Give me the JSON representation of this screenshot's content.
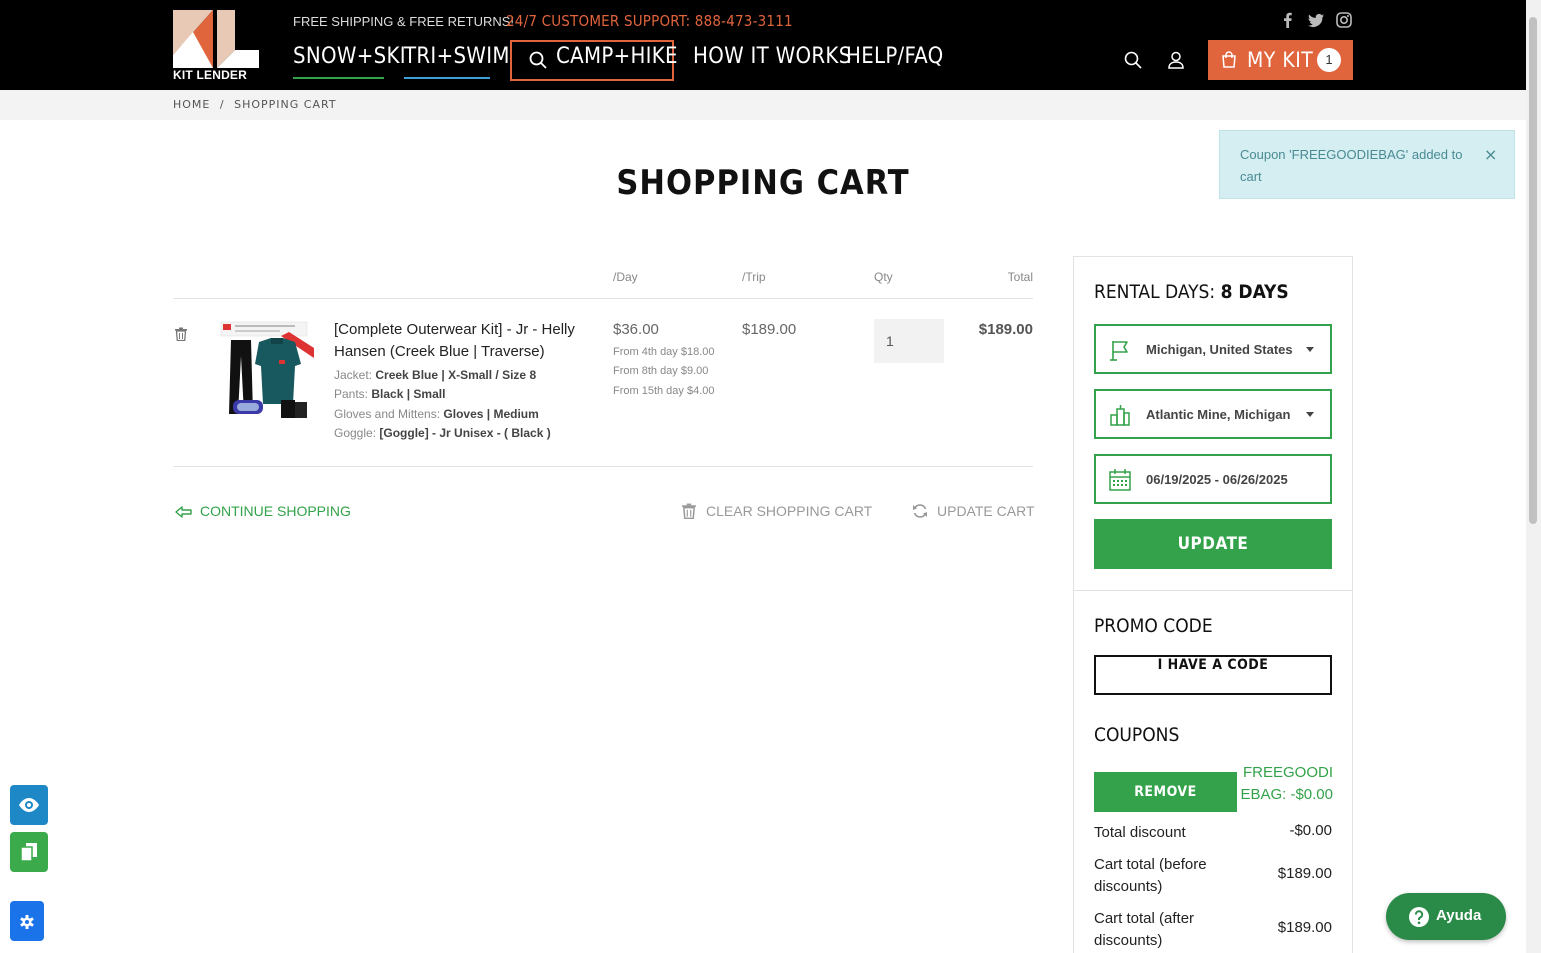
{
  "header": {
    "logo_text": "KIT LENDER",
    "promo": "FREE SHIPPING & FREE RETURNS!",
    "support": "24/7 CUSTOMER SUPPORT: 888-473-3111",
    "nav": [
      "SNOW+SKI",
      "TRI+SWIM",
      "CAMP+HIKE",
      "HOW IT WORKS",
      "HELP/FAQ"
    ],
    "kit_label": "MY KIT",
    "kit_count": "1",
    "accent_color": "#e0643c"
  },
  "breadcrumb": [
    "HOME",
    "/",
    "SHOPPING CART"
  ],
  "toast": {
    "message": "Coupon 'FREEGOODIEBAG' added to cart",
    "close": "×"
  },
  "page_title": "SHOPPING CART",
  "cart": {
    "columns": {
      "day": "/Day",
      "trip": "/Trip",
      "qty": "Qty",
      "total": "Total"
    },
    "item": {
      "title": "[Complete Outerwear Kit] - Jr - Helly Hansen (Creek Blue | Traverse)",
      "attributes": [
        {
          "label": "Jacket:",
          "value": "Creek Blue | X-Small / Size 8"
        },
        {
          "label": "Pants:",
          "value": "Black | Small"
        },
        {
          "label": "Gloves and Mittens:",
          "value": "Gloves | Medium"
        },
        {
          "label": "Goggle:",
          "value": "[Goggle] - Jr Unisex - ( Black )"
        }
      ],
      "price_day": "$36.00",
      "tiers": [
        "From 4th day $18.00",
        "From 8th day $9.00",
        "From 15th day $4.00"
      ],
      "price_trip": "$189.00",
      "qty": "1",
      "total": "$189.00"
    },
    "actions": {
      "continue": "CONTINUE SHOPPING",
      "clear": "CLEAR SHOPPING CART",
      "update": "UPDATE CART"
    }
  },
  "sidebar": {
    "rental_days_label": "RENTAL DAYS:",
    "rental_days_value": "8 DAYS",
    "state": "Michigan, United States",
    "city": "Atlantic Mine, Michigan",
    "dates": "06/19/2025 - 06/26/2025",
    "update_label": "UPDATE",
    "promo_heading": "PROMO CODE",
    "code_button": "I HAVE A CODE",
    "coupons_heading": "COUPONS",
    "remove_label": "REMOVE",
    "coupon": "FREEGOODIEBAG: -$0.00",
    "summary": [
      {
        "label": "Total discount",
        "value": "-$0.00"
      },
      {
        "label": "Cart total (before discounts)",
        "value": "$189.00"
      },
      {
        "label": "Cart total (after discounts)",
        "value": "$189.00"
      }
    ],
    "brand_green": "#33a24a"
  },
  "help_label": "Ayuda"
}
